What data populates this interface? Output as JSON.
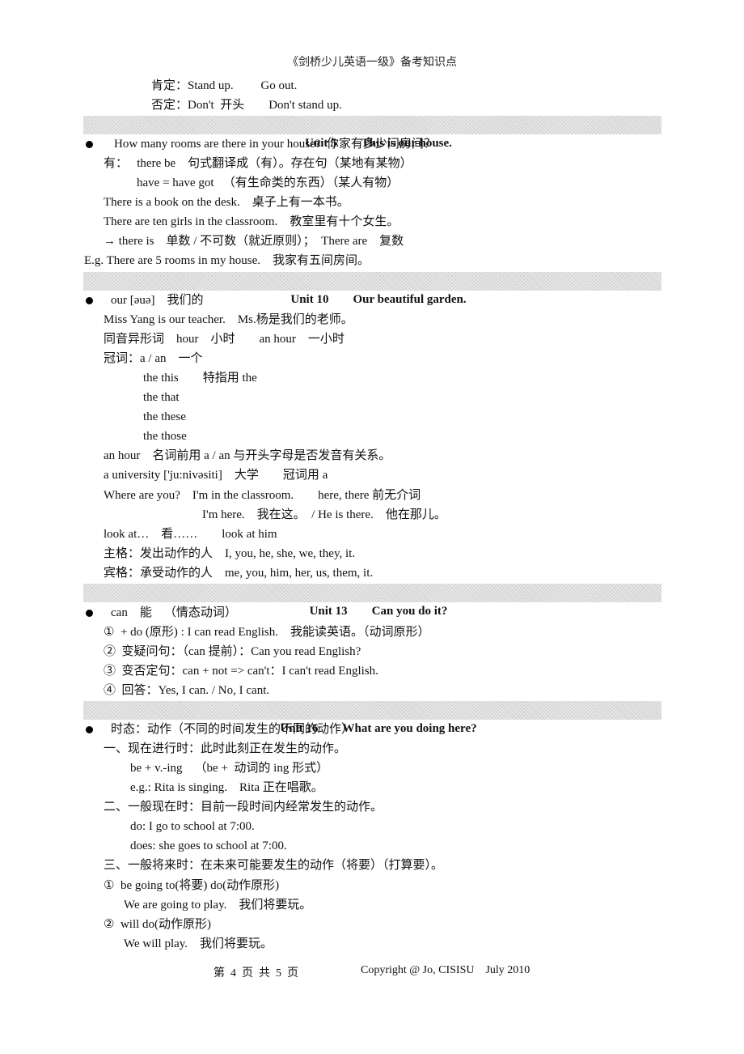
{
  "header": {
    "title": "《剑桥少儿英语一级》备考知识点"
  },
  "intro": {
    "affirmative": "肯定：Stand up.         Go out.",
    "negative": "否定：Don't  开头        Don't stand up."
  },
  "units": [
    {
      "unit": "Unit 5",
      "title": "This is our house.",
      "lines": [
        "How many rooms are there in your house?  你家有多少间房间？",
        "有：   there be    句式翻译成（有）。存在句（某地有某物）",
        "have = have got   （有生命类的东西）（某人有物）",
        "There is a book on the desk.    桌子上有一本书。",
        "There are ten girls in the classroom.    教室里有十个女生。",
        "→ there is    单数 / 不可数（就近原则）；  There are    复数",
        "E.g. There are 5 rooms in my house.    我家有五间房间。"
      ]
    },
    {
      "unit": "Unit 10",
      "title": "Our beautiful garden.",
      "lines": [
        "our [əuə]    我们的",
        "Miss Yang is our teacher.    Ms.杨是我们的老师。",
        "同音异形词    hour    小时        an hour    一小时",
        "冠词：a / an    一个",
        "the this        特指用 the",
        "the that",
        "the these",
        "the those",
        "an hour    名词前用 a / an 与开头字母是否发音有关系。",
        "a university ['ju:nivəsiti]    大学        冠词用 a",
        "Where are you?    I'm in the classroom.        here, there 前无介词",
        "I'm here.    我在这。  / He is there.    他在那儿。",
        "look at…    看……        look at him",
        "主格：发出动作的人    I, you, he, she, we, they, it.",
        "宾格：承受动作的人    me, you, him, her, us, them, it."
      ]
    },
    {
      "unit": "Unit 13",
      "title": "Can you do it?",
      "lines": [
        "can    能    （情态动词）",
        "①  + do (原形) : I can read English.    我能读英语。（动词原形）",
        "②  变疑问句：（can 提前）：Can you read English?",
        "③  变否定句：can + not => can't：I can't read English.",
        "④  回答：Yes, I can. / No, I cant."
      ]
    },
    {
      "unit": "Unit 16",
      "title": "What are you doing here?",
      "lines": [
        "时态：动作（不同的时间发生的不同的动作）",
        "一、现在进行时：此时此刻正在发生的动作。",
        "be + v.-ing    （be +  动词的 ing 形式）",
        "e.g.: Rita is singing.    Rita 正在唱歌。",
        "二、一般现在时：目前一段时间内经常发生的动作。",
        "do: I go to school at 7:00.",
        "does: she goes to school at 7:00.",
        "三、一般将来时：在未来可能要发生的动作（将要）（打算要）。",
        "①  be going to(将要) do(动作原形)",
        "We are going to play.    我们将要玩。",
        "②  will do(动作原形)",
        "We will play.    我们将要玩。"
      ]
    }
  ],
  "footer": {
    "page": "第  4  页  共  5  页",
    "copyright": "Copyright @ Jo, CISISU    July 2010"
  }
}
